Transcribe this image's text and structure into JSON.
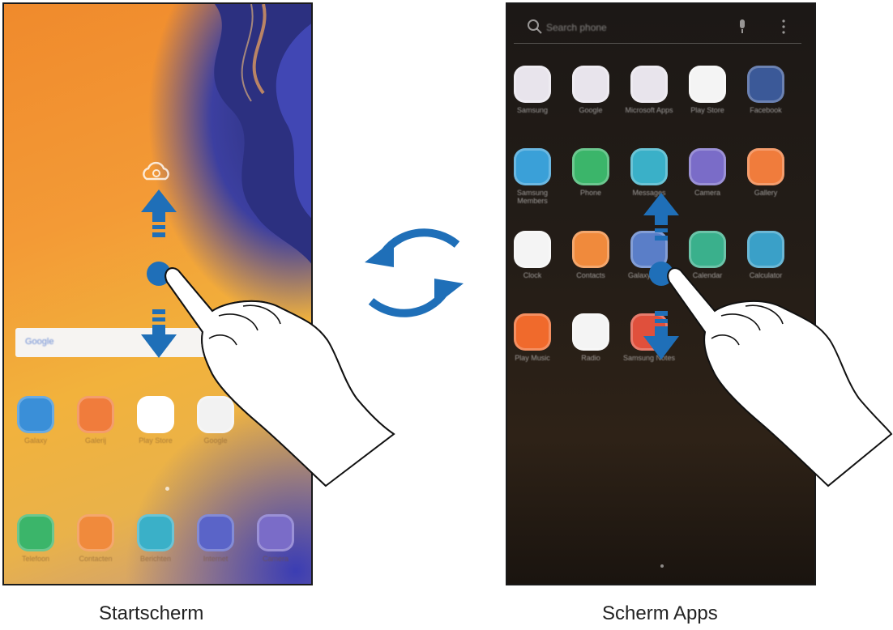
{
  "captions": {
    "home": "Startscherm",
    "apps": "Scherm Apps"
  },
  "home_screen": {
    "search_widget": "Google",
    "apps": [
      {
        "label": "Galaxy",
        "icon": "galaxy-store-icon",
        "color": "#3a8fd8"
      },
      {
        "label": "Galerij",
        "icon": "gallery-icon",
        "color": "#f07c3c"
      },
      {
        "label": "Play Store",
        "icon": "play-store-icon",
        "color": "#ffffff"
      },
      {
        "label": "Google",
        "icon": "google-folder-icon",
        "color": "#f2f2f2"
      }
    ],
    "dock": [
      {
        "label": "Telefoon",
        "icon": "phone-icon",
        "color": "#3bb56a"
      },
      {
        "label": "Contacten",
        "icon": "contacts-icon",
        "color": "#f08a3c"
      },
      {
        "label": "Berichten",
        "icon": "messages-icon",
        "color": "#3ab0c8"
      },
      {
        "label": "Internet",
        "icon": "internet-icon",
        "color": "#5a64c8"
      },
      {
        "label": "Camera",
        "icon": "camera-icon",
        "color": "#7a6cc8"
      }
    ]
  },
  "apps_screen": {
    "search_placeholder": "Search phone",
    "apps": [
      {
        "label": "Samsung",
        "icon": "samsung-folder-icon",
        "color": "#e8e4ec"
      },
      {
        "label": "Google",
        "icon": "google-folder-icon",
        "color": "#e8e4ec"
      },
      {
        "label": "Microsoft Apps",
        "icon": "microsoft-folder-icon",
        "color": "#e8e4ec"
      },
      {
        "label": "Play Store",
        "icon": "play-store-icon",
        "color": "#f4f4f4"
      },
      {
        "label": "Facebook",
        "icon": "facebook-icon",
        "color": "#3b5998"
      },
      {
        "label": "Samsung Members",
        "icon": "samsung-members-icon",
        "color": "#3aa0d8"
      },
      {
        "label": "Phone",
        "icon": "phone-icon",
        "color": "#3bb56a"
      },
      {
        "label": "Messages",
        "icon": "messages-icon",
        "color": "#3ab0c8"
      },
      {
        "label": "Camera",
        "icon": "camera-icon",
        "color": "#7a6cc8"
      },
      {
        "label": "Gallery",
        "icon": "gallery-icon",
        "color": "#f07c3c"
      },
      {
        "label": "Clock",
        "icon": "clock-icon",
        "color": "#f4f4f4"
      },
      {
        "label": "Contacts",
        "icon": "contacts-icon",
        "color": "#f08a3c"
      },
      {
        "label": "Galaxy Store",
        "icon": "galaxy-store-icon",
        "color": "#5a7ec8"
      },
      {
        "label": "Calendar",
        "icon": "calendar-icon",
        "color": "#3ab08c"
      },
      {
        "label": "Calculator",
        "icon": "calculator-icon",
        "color": "#3aa0c8"
      },
      {
        "label": "Play Music",
        "icon": "play-music-icon",
        "color": "#f06a2c"
      },
      {
        "label": "Radio",
        "icon": "radio-icon",
        "color": "#f4f4f4"
      },
      {
        "label": "Samsung Notes",
        "icon": "samsung-notes-icon",
        "color": "#e0503c"
      }
    ]
  },
  "colors": {
    "arrow": "#1f6fb8",
    "rotate_arrows": "#1f6fb8"
  }
}
